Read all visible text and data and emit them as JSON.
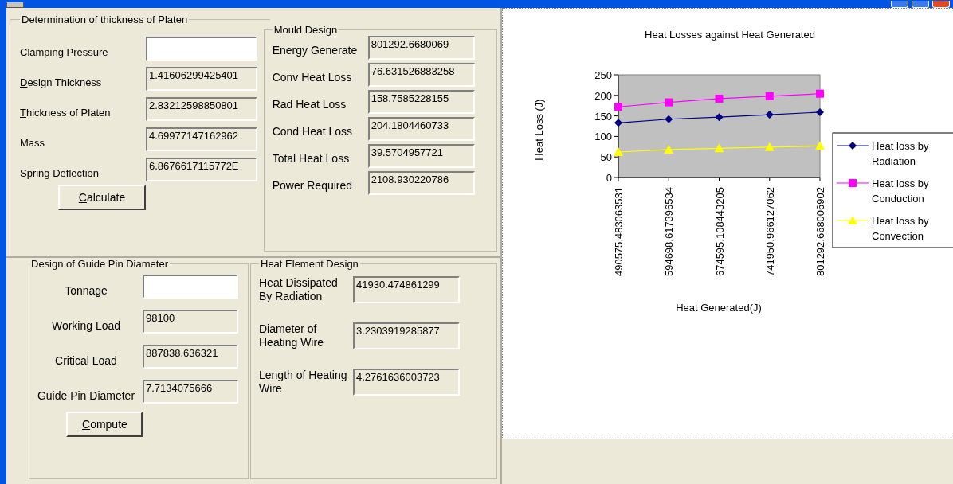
{
  "platen": {
    "title": "Determination of thickness of Platen",
    "fields": [
      {
        "label": "Clamping Pressure",
        "editable": true
      },
      {
        "label": "esign Thickness",
        "value": "1.41606299425401",
        "editable": false,
        "underline": "D"
      },
      {
        "label": "hickness of Platen",
        "value": "2.83212598850801",
        "editable": false,
        "underline": "T"
      },
      {
        "label": "Mass",
        "value": "4.69977147162962",
        "editable": false
      },
      {
        "label": "Spring Deflection",
        "value": "6.8676617115772E",
        "editable": false
      }
    ],
    "button": {
      "underline": "C",
      "label": "alculate"
    }
  },
  "mould": {
    "title": "Mould Design",
    "fields": [
      {
        "label": "Energy Generate",
        "value": "801292.6680069"
      },
      {
        "label": "Conv Heat Loss",
        "value": "76.631526883258"
      },
      {
        "label": "Rad Heat Loss",
        "value": "158.7585228155"
      },
      {
        "label": "Cond Heat Loss",
        "value": "204.1804460733"
      },
      {
        "label": "Total Heat Loss",
        "value": "39.5704957721"
      },
      {
        "label": "Power Required",
        "value": "2108.930220786"
      }
    ]
  },
  "guide_pin": {
    "title": "Design of Guide Pin Diameter",
    "fields": [
      {
        "label": "Tonnage",
        "editable": true
      },
      {
        "label": "Working Load",
        "value": "98100",
        "editable": false
      },
      {
        "label": "Critical Load",
        "value": "887838.636321",
        "editable": false
      },
      {
        "label": "Guide Pin Diameter",
        "value": "7.7134075666",
        "editable": false
      }
    ],
    "button": {
      "underline": "C",
      "label": "ompute"
    }
  },
  "heat_element": {
    "title": "Heat Element Design",
    "fields": [
      {
        "label": "Heat Dissipated By Radiation",
        "value": "41930.474861299"
      },
      {
        "label": "Diameter of Heating Wire",
        "value": "3.2303919285877"
      },
      {
        "label": "Length of Heating Wire",
        "value": "4.2761636003723"
      }
    ]
  },
  "chart": {
    "chart_data": {
      "type": "line",
      "title": "Heat Losses against Heat Generated",
      "xlabel": "Heat Generated(J)",
      "ylabel": "Heat Loss (J)",
      "categories": [
        "490575.483063531",
        "594698.617396534",
        "674595.108443205",
        "741950.966127062",
        "801292.668006902"
      ],
      "ylim": [
        0,
        250
      ],
      "legend": true,
      "yticks": [
        0,
        50,
        100,
        150,
        200,
        250
      ],
      "series": [
        {
          "name": "Heat loss by Radiation",
          "color": "#000080",
          "marker": "diamond",
          "values": [
            133,
            142,
            147,
            153,
            159
          ]
        },
        {
          "name": "Heat loss by Conduction",
          "color": "#ff00ff",
          "marker": "square",
          "values": [
            172,
            183,
            192,
            198,
            204
          ]
        },
        {
          "name": "Heat loss by Convection",
          "color": "#ffff00",
          "marker": "triangle",
          "values": [
            62,
            68,
            71,
            74,
            77
          ]
        }
      ]
    }
  }
}
